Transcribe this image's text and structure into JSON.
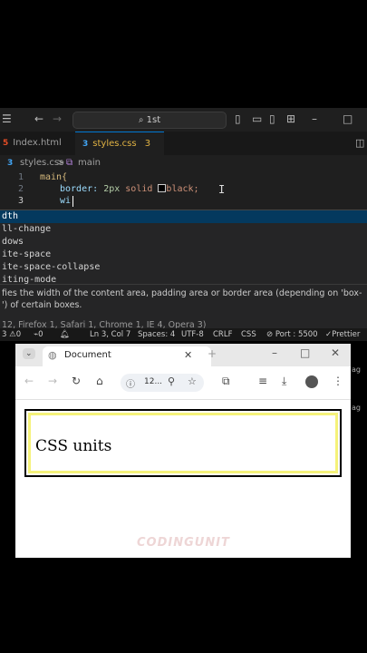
{
  "vscode": {
    "search": "1st",
    "tabs": [
      {
        "label": "Index.html",
        "active": false
      },
      {
        "label": "styles.css",
        "badge": "3",
        "active": true
      }
    ],
    "breadcrumb": {
      "file": "styles.css",
      "separator": ">",
      "symbol": "main"
    },
    "code_lines": [
      {
        "num": "1",
        "text": "main{"
      },
      {
        "num": "2",
        "prop": "border:",
        "v1": "2px",
        "v2": "solid",
        "v3": "black;"
      },
      {
        "num": "3",
        "text": "wi"
      }
    ],
    "suggestions": [
      "dth",
      "ll-change",
      "dows",
      "ite-space",
      "ite-space-collapse",
      "iting-mode"
    ],
    "doc_line1": "fies the width of the content area, padding area or border area (depending on 'box-",
    "doc_line2": "') of certain boxes.",
    "doc_line3": "12, Firefox 1, Safari 1, Chrome 1, IE 4, Opera 3)",
    "status": {
      "errors": "3",
      "warnings": "0",
      "ports": "0",
      "position": "Ln 3, Col 7",
      "spaces": "Spaces: 4",
      "encoding": "UTF-8",
      "eol": "CRLF",
      "language": "CSS",
      "port": "Port : 5500",
      "formatter": "Prettier"
    }
  },
  "browser": {
    "tab_title": "Document",
    "url": "12...",
    "page_heading": "CSS units",
    "watermark": "CODINGUNIT"
  },
  "side_text": [
    "ag",
    "ag"
  ],
  "colors": {
    "accent": "#0078d4",
    "tab_active_text": "#e0b243",
    "page_bg_inner": "#f5f27a"
  }
}
